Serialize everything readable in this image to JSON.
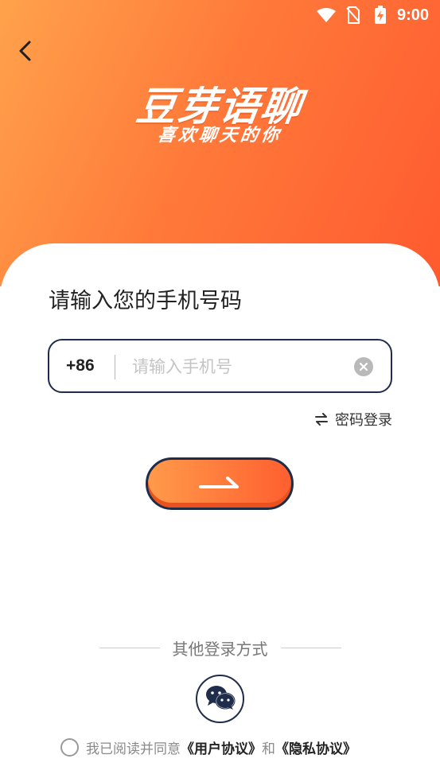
{
  "status_bar": {
    "time": "9:00",
    "icons": [
      "wifi-icon",
      "no-sim-icon",
      "battery-charging-icon"
    ]
  },
  "header": {
    "back_icon": "chevron-left-icon",
    "app_name": "豆芽语聊",
    "slogan": "喜欢聊天的你"
  },
  "login": {
    "prompt": "请输入您的手机号码",
    "country_code": "+86",
    "phone_placeholder": "请输入手机号",
    "phone_value": "",
    "clear_icon": "clear-icon",
    "password_login_label": "密码登录",
    "password_login_icon": "swap-arrows-icon",
    "next_icon": "arrow-right-icon"
  },
  "other_login": {
    "label": "其他登录方式",
    "wechat_icon": "wechat-icon"
  },
  "agreement": {
    "prefix": "我已阅读并同意",
    "user_agreement": "《用户协议》",
    "conjunction": "和",
    "privacy_agreement": "《隐私协议》"
  },
  "colors": {
    "gradient_start": "#ffa24c",
    "gradient_end": "#ff5a2f",
    "outline": "#1f2d4a",
    "text_primary": "#222222",
    "placeholder": "#c4c4c4"
  }
}
